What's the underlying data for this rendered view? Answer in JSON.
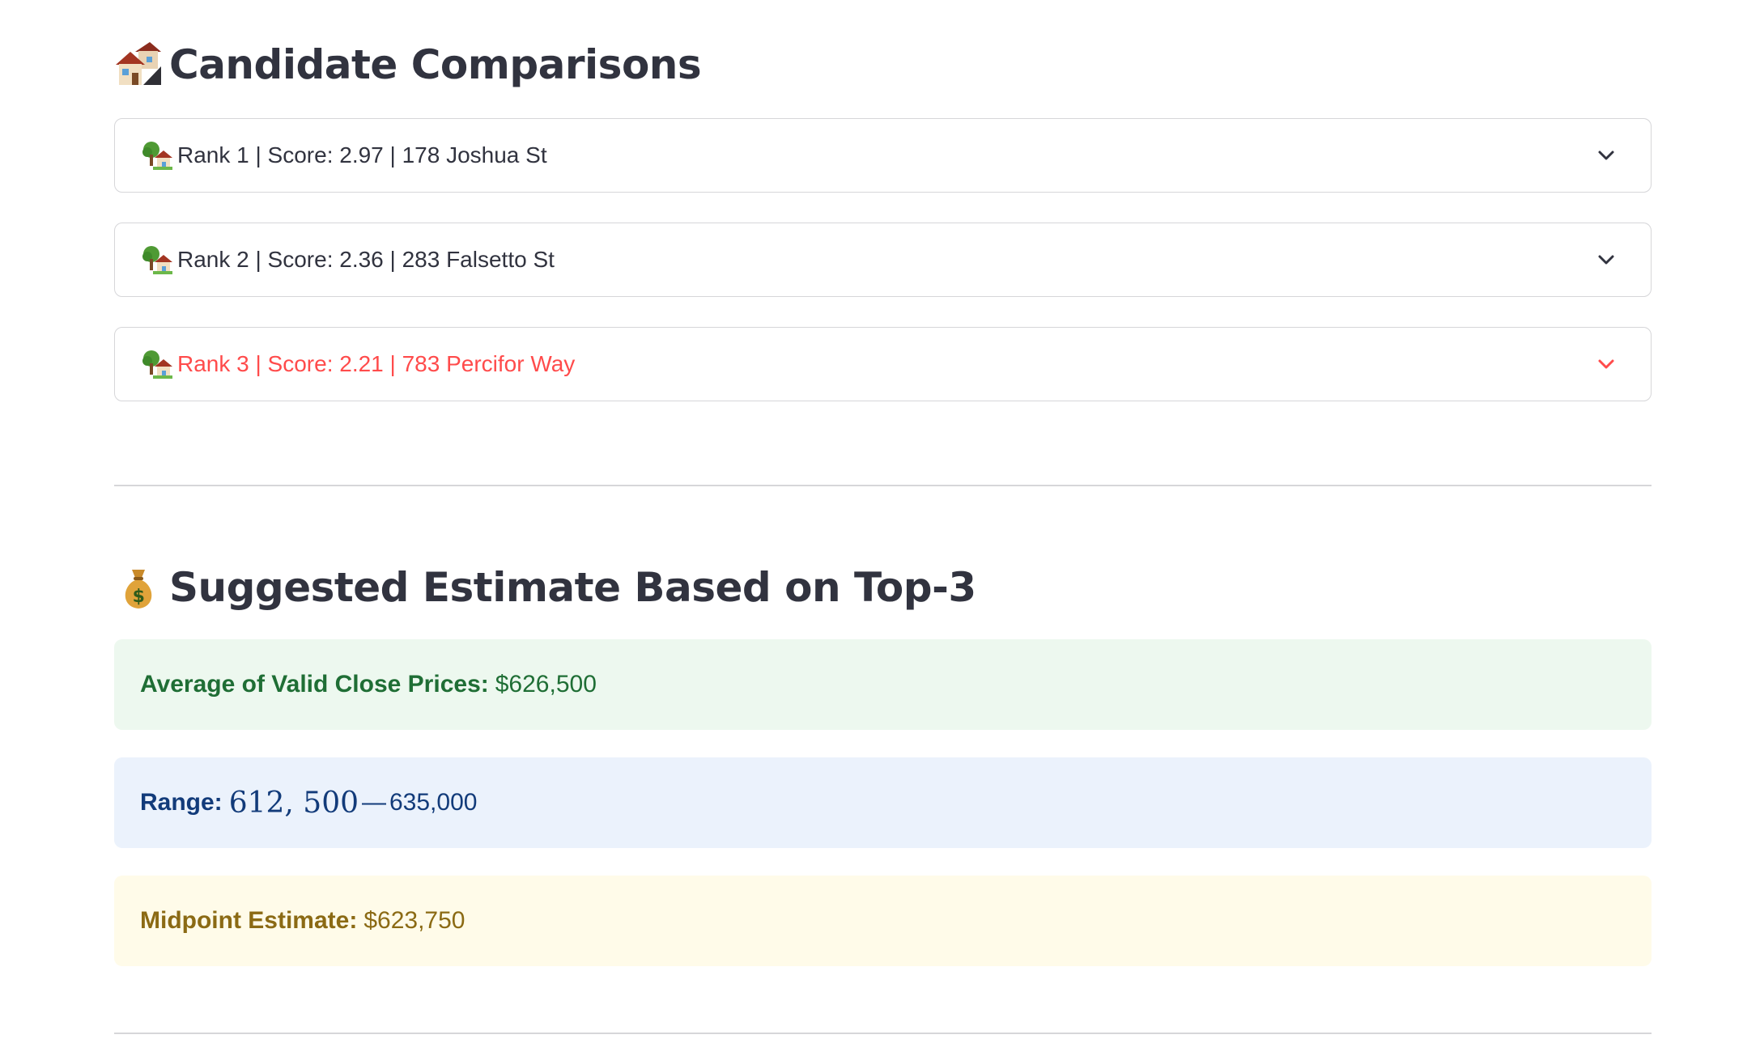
{
  "sections": {
    "candidates": {
      "title": "Candidate Comparisons",
      "icon": "houses-icon"
    },
    "estimate": {
      "title": "Suggested Estimate Based on Top-3",
      "icon": "money-bag-icon"
    }
  },
  "candidates": [
    {
      "label": "Rank 1 | Score: 2.97 | 178 Joshua St",
      "icon": "house-with-garden-icon",
      "expanded": false
    },
    {
      "label": "Rank 2 | Score: 2.36 | 283 Falsetto St",
      "icon": "house-with-garden-icon",
      "expanded": false
    },
    {
      "label": "Rank 3 | Score: 2.21 | 783 Percifor Way",
      "icon": "house-with-garden-icon",
      "expanded": false,
      "hovered": true
    }
  ],
  "estimate": {
    "average": {
      "label": "Average of Valid Close Prices:",
      "value": "$626,500"
    },
    "range": {
      "label": "Range:",
      "low": "612, 500",
      "dash": "—",
      "high": "635,000"
    },
    "midpoint": {
      "label": "Midpoint Estimate:",
      "value": "$623,750"
    }
  },
  "colors": {
    "text": "#31333f",
    "accent": "#ff4b4b",
    "success_bg": "#edf8ef",
    "success_text": "#1f6e35",
    "info_bg": "#ebf2fc",
    "info_text": "#123b7a",
    "warning_bg": "#fffbe9",
    "warning_text": "#8b6a14",
    "border": "#d6d6d9"
  }
}
